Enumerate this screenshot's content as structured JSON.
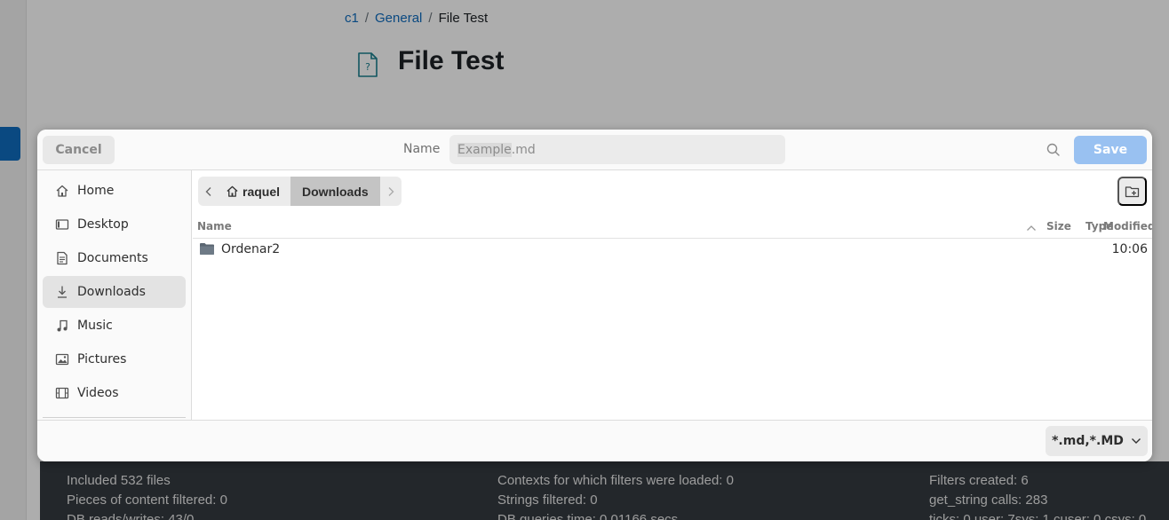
{
  "background": {
    "breadcrumb": {
      "c1": "c1",
      "general": "General",
      "current": "File Test",
      "separator": "/"
    },
    "page_title": "File Test",
    "footer": {
      "col1": [
        "Included 532 files",
        "Pieces of content filtered: 0",
        "DB reads/writes: 43/0"
      ],
      "col2": [
        "Contexts for which filters were loaded: 0",
        "Strings filtered: 0",
        "DB queries time: 0.01166 secs"
      ],
      "col3": [
        "Filters created: 6",
        "get_string calls: 283",
        "ticks: 0 user: 7sys: 1 cuser: 0 csys: 0"
      ]
    }
  },
  "dialog": {
    "header": {
      "cancel_label": "Cancel",
      "name_label": "Name",
      "name_value_selected": "Example",
      "name_value_rest": ".md",
      "save_label": "Save"
    },
    "sidebar": [
      {
        "label": "Home",
        "icon": "home-icon"
      },
      {
        "label": "Desktop",
        "icon": "desktop-icon"
      },
      {
        "label": "Documents",
        "icon": "documents-icon"
      },
      {
        "label": "Downloads",
        "icon": "downloads-icon",
        "active": true
      },
      {
        "label": "Music",
        "icon": "music-icon"
      },
      {
        "label": "Pictures",
        "icon": "pictures-icon"
      },
      {
        "label": "Videos",
        "icon": "videos-icon"
      }
    ],
    "path": {
      "home": "raquel",
      "current": "Downloads"
    },
    "columns": {
      "name": "Name",
      "size": "Size",
      "type": "Type",
      "modified": "Modified"
    },
    "files": [
      {
        "name": "Ordenar2",
        "modified": "10:06",
        "kind": "folder"
      }
    ],
    "filter": "*.md,*.MD"
  },
  "colors": {
    "accent": "#99c1f1",
    "link": "#0f6cbf",
    "footer_bg": "#343a40"
  }
}
